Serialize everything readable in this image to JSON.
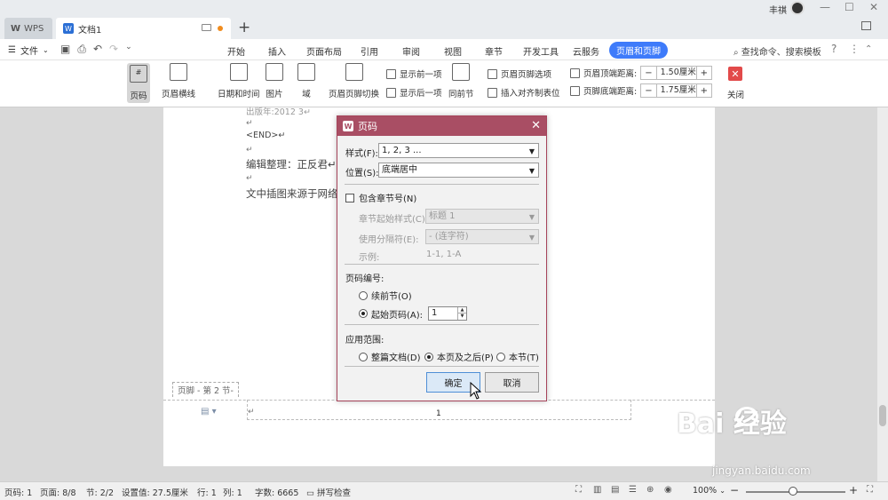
{
  "titlebar": {
    "app_tab": "WPS",
    "doc_tab": "文档1",
    "new_tab": "+",
    "user_name": "丰祺",
    "win_min": "—",
    "win_max": "☐",
    "win_close": "✕"
  },
  "menu": {
    "file": "文件",
    "ribbon_tabs": [
      "开始",
      "插入",
      "页面布局",
      "引用",
      "审阅",
      "视图",
      "章节",
      "开发工具",
      "云服务",
      "页眉和页脚"
    ],
    "active_tab": "页眉和页脚",
    "search": "查找命令、搜索模板",
    "help": "?"
  },
  "ribbon": {
    "page_number": "页码",
    "header_line": "页眉横线",
    "datetime": "日期和时间",
    "picture": "图片",
    "field": "域",
    "header_footer_switch": "页眉页脚切换",
    "show_prev": "显示前一项",
    "show_next": "显示后一项",
    "same_as_prev": "同前节",
    "header_footer_options": "页眉页脚选项",
    "insert_align_tab": "插入对齐制表位",
    "header_top_dist_label": "页眉顶端距离:",
    "header_top_dist": "1.50厘米",
    "footer_bottom_dist_label": "页脚底端距离:",
    "footer_bottom_dist": "1.75厘米",
    "minus": "−",
    "plus": "+",
    "close": "关闭"
  },
  "document": {
    "line1": "出版年:2012 3↵",
    "return1": "↵",
    "end_line": "<END>↵",
    "return2": "↵",
    "editor_line": "编辑整理：正反君↵",
    "return3": "↵",
    "source_line": "文中插图来源于网络↵",
    "footer_tag": "页脚 - 第 2 节-",
    "footer_return": "↵",
    "page_number": "1"
  },
  "dialog": {
    "title": "页码",
    "style_label": "样式(F):",
    "style_value": "1, 2, 3 ...",
    "position_label": "位置(S):",
    "position_value": "底端居中",
    "include_chapter": "包含章节号(N)",
    "chapter_start_label": "章节起始样式(C):",
    "chapter_start_value": "标题 1",
    "separator_label": "使用分隔符(E):",
    "separator_value": "-   (连字符)",
    "example_label": "示例:",
    "example_value": "1-1, 1-A",
    "numbering_header": "页码编号:",
    "continue_prev": "续前节(O)",
    "start_at": "起始页码(A):",
    "start_value": "1",
    "apply_header": "应用范围:",
    "apply_whole": "整篇文档(D)",
    "apply_this_after": "本页及之后(P)",
    "apply_section": "本节(T)",
    "ok": "确定",
    "cancel": "取消"
  },
  "status": {
    "page_code": "页码: 1",
    "pages": "页面: 8/8",
    "section": "节: 2/2",
    "position": "设置值: 27.5厘米",
    "row": "行: 1",
    "col": "列: 1",
    "word_count": "字数: 6665",
    "spell_check": "拼写检查",
    "zoom": "100%",
    "zoom_minus": "−",
    "zoom_plus": "+"
  },
  "watermark": {
    "brand": "Bai 经验",
    "url": "jingyan.baidu.com"
  }
}
